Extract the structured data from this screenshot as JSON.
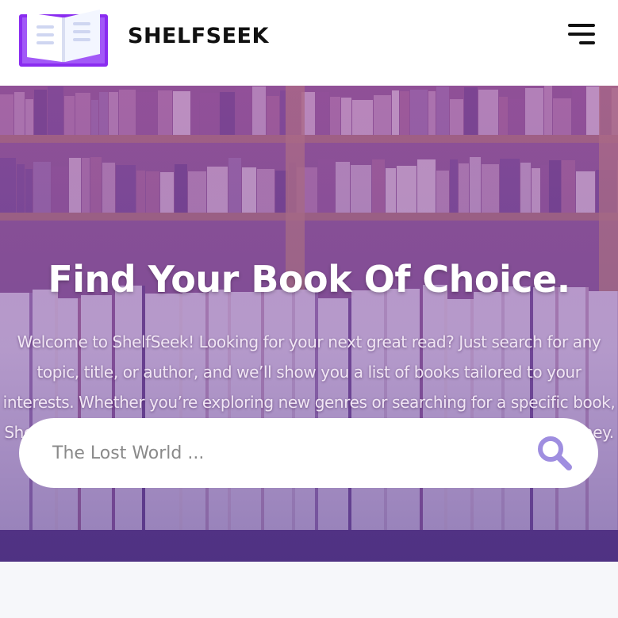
{
  "header": {
    "brand": "SHELFSEEK",
    "logo_icon": "open-book-icon",
    "menu_icon": "hamburger-menu-icon"
  },
  "hero": {
    "title": "Find Your Book Of Choice.",
    "description": "Welcome to ShelfSeek! Looking for your next great read? Just search for any topic, title, or author, and we’ll show you a list of books tailored to your interests. Whether you’re exploring new genres or searching for a specific book, ShelfSeek makes it easy to discover the perfect match for your reading journey."
  },
  "search": {
    "placeholder": "The Lost World ...",
    "value": "",
    "icon": "search-icon"
  },
  "colors": {
    "accent": "#8f4dff",
    "logo_purple": "#8a2cf0",
    "search_icon": "#9f8ee0",
    "hero_tint": "#8a4ab0"
  }
}
